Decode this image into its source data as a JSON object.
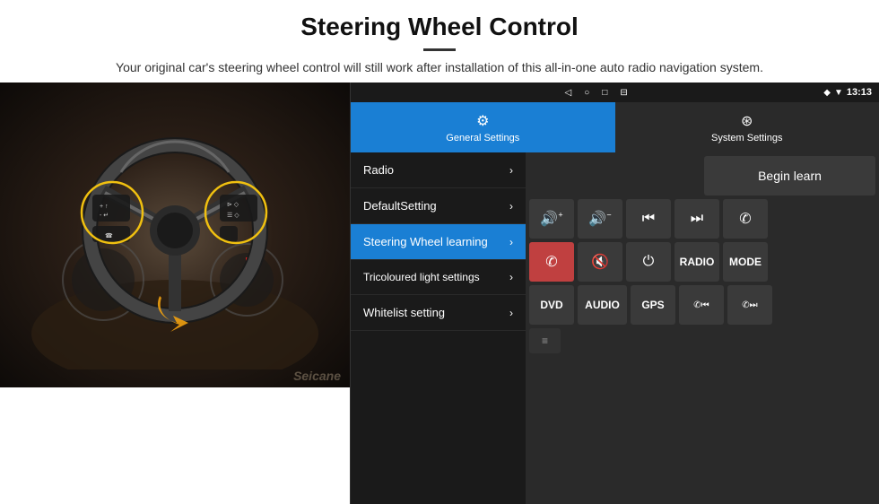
{
  "header": {
    "title": "Steering Wheel Control",
    "divider": true,
    "subtitle": "Your original car's steering wheel control will still work after installation of this all-in-one auto radio navigation system."
  },
  "statusBar": {
    "icons": [
      "◁",
      "○",
      "□",
      "⊟"
    ],
    "rightIcons": [
      "◆",
      "▼"
    ],
    "time": "13:13"
  },
  "tabs": [
    {
      "id": "general",
      "label": "General Settings",
      "icon": "⚙",
      "active": true
    },
    {
      "id": "system",
      "label": "System Settings",
      "icon": "🔧",
      "active": false
    }
  ],
  "menu": [
    {
      "id": "radio",
      "label": "Radio",
      "active": false
    },
    {
      "id": "default",
      "label": "DefaultSetting",
      "active": false
    },
    {
      "id": "steering",
      "label": "Steering Wheel learning",
      "active": true
    },
    {
      "id": "tricoloured",
      "label": "Tricoloured light settings",
      "active": false
    },
    {
      "id": "whitelist",
      "label": "Whitelist setting",
      "active": false
    }
  ],
  "controls": {
    "begin_learn": "Begin learn",
    "buttons": [
      [
        {
          "id": "vol-up",
          "icon": "🔊+",
          "label": "🔊+"
        },
        {
          "id": "vol-down",
          "icon": "🔊-",
          "label": "🔊−"
        },
        {
          "id": "prev-track",
          "icon": "⏮",
          "label": "⏮"
        },
        {
          "id": "next-track",
          "icon": "⏭",
          "label": "⏭"
        },
        {
          "id": "phone",
          "icon": "📞",
          "label": "✆"
        }
      ],
      [
        {
          "id": "hang-up",
          "icon": "📵",
          "label": "✆"
        },
        {
          "id": "mute",
          "icon": "🔇",
          "label": "🔇×"
        },
        {
          "id": "power",
          "icon": "⏻",
          "label": "⏻"
        },
        {
          "id": "radio-btn",
          "text": "RADIO",
          "label": "RADIO"
        },
        {
          "id": "mode-btn",
          "text": "MODE",
          "label": "MODE"
        }
      ],
      [
        {
          "id": "dvd-btn",
          "text": "DVD",
          "label": "DVD"
        },
        {
          "id": "audio-btn",
          "text": "AUDIO",
          "label": "AUDIO"
        },
        {
          "id": "gps-btn",
          "text": "GPS",
          "label": "GPS"
        },
        {
          "id": "tel-prev",
          "icon": "📞⏮",
          "label": "✆⏮"
        },
        {
          "id": "tel-next",
          "icon": "📞⏭",
          "label": "✆⏭"
        }
      ]
    ]
  },
  "watermark": "Seicane"
}
